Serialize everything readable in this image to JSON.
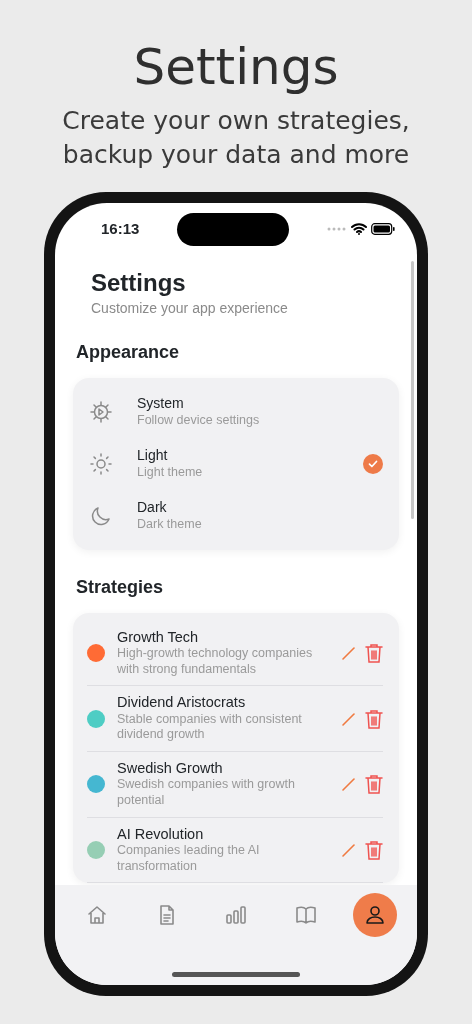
{
  "headline": {
    "title": "Settings",
    "subtitle": "Create your own strategies, backup your data and more"
  },
  "status_bar": {
    "time": "16:13"
  },
  "page": {
    "title": "Settings",
    "subtitle": "Customize your app experience"
  },
  "appearance": {
    "heading": "Appearance",
    "options": [
      {
        "kind": "system",
        "label": "System",
        "description": "Follow device settings",
        "selected": false
      },
      {
        "kind": "light",
        "label": "Light",
        "description": "Light theme",
        "selected": true
      },
      {
        "kind": "dark",
        "label": "Dark",
        "description": "Dark theme",
        "selected": false
      }
    ]
  },
  "strategies": {
    "heading": "Strategies",
    "items": [
      {
        "name": "Growth Tech",
        "description": "High-growth technology companies with strong fundamentals",
        "color": "#ff6b35"
      },
      {
        "name": "Dividend Aristocrats",
        "description": "Stable companies with consistent dividend growth",
        "color": "#4ecdc4"
      },
      {
        "name": "Swedish Growth",
        "description": "Swedish companies with growth potential",
        "color": "#45b7d1"
      },
      {
        "name": "AI Revolution",
        "description": "Companies leading the AI transformation",
        "color": "#96ceb4"
      }
    ]
  },
  "tab_bar": [
    {
      "kind": "home",
      "selected": false
    },
    {
      "kind": "document",
      "selected": false
    },
    {
      "kind": "chart",
      "selected": false
    },
    {
      "kind": "book",
      "selected": false
    },
    {
      "kind": "profile",
      "selected": true
    }
  ]
}
